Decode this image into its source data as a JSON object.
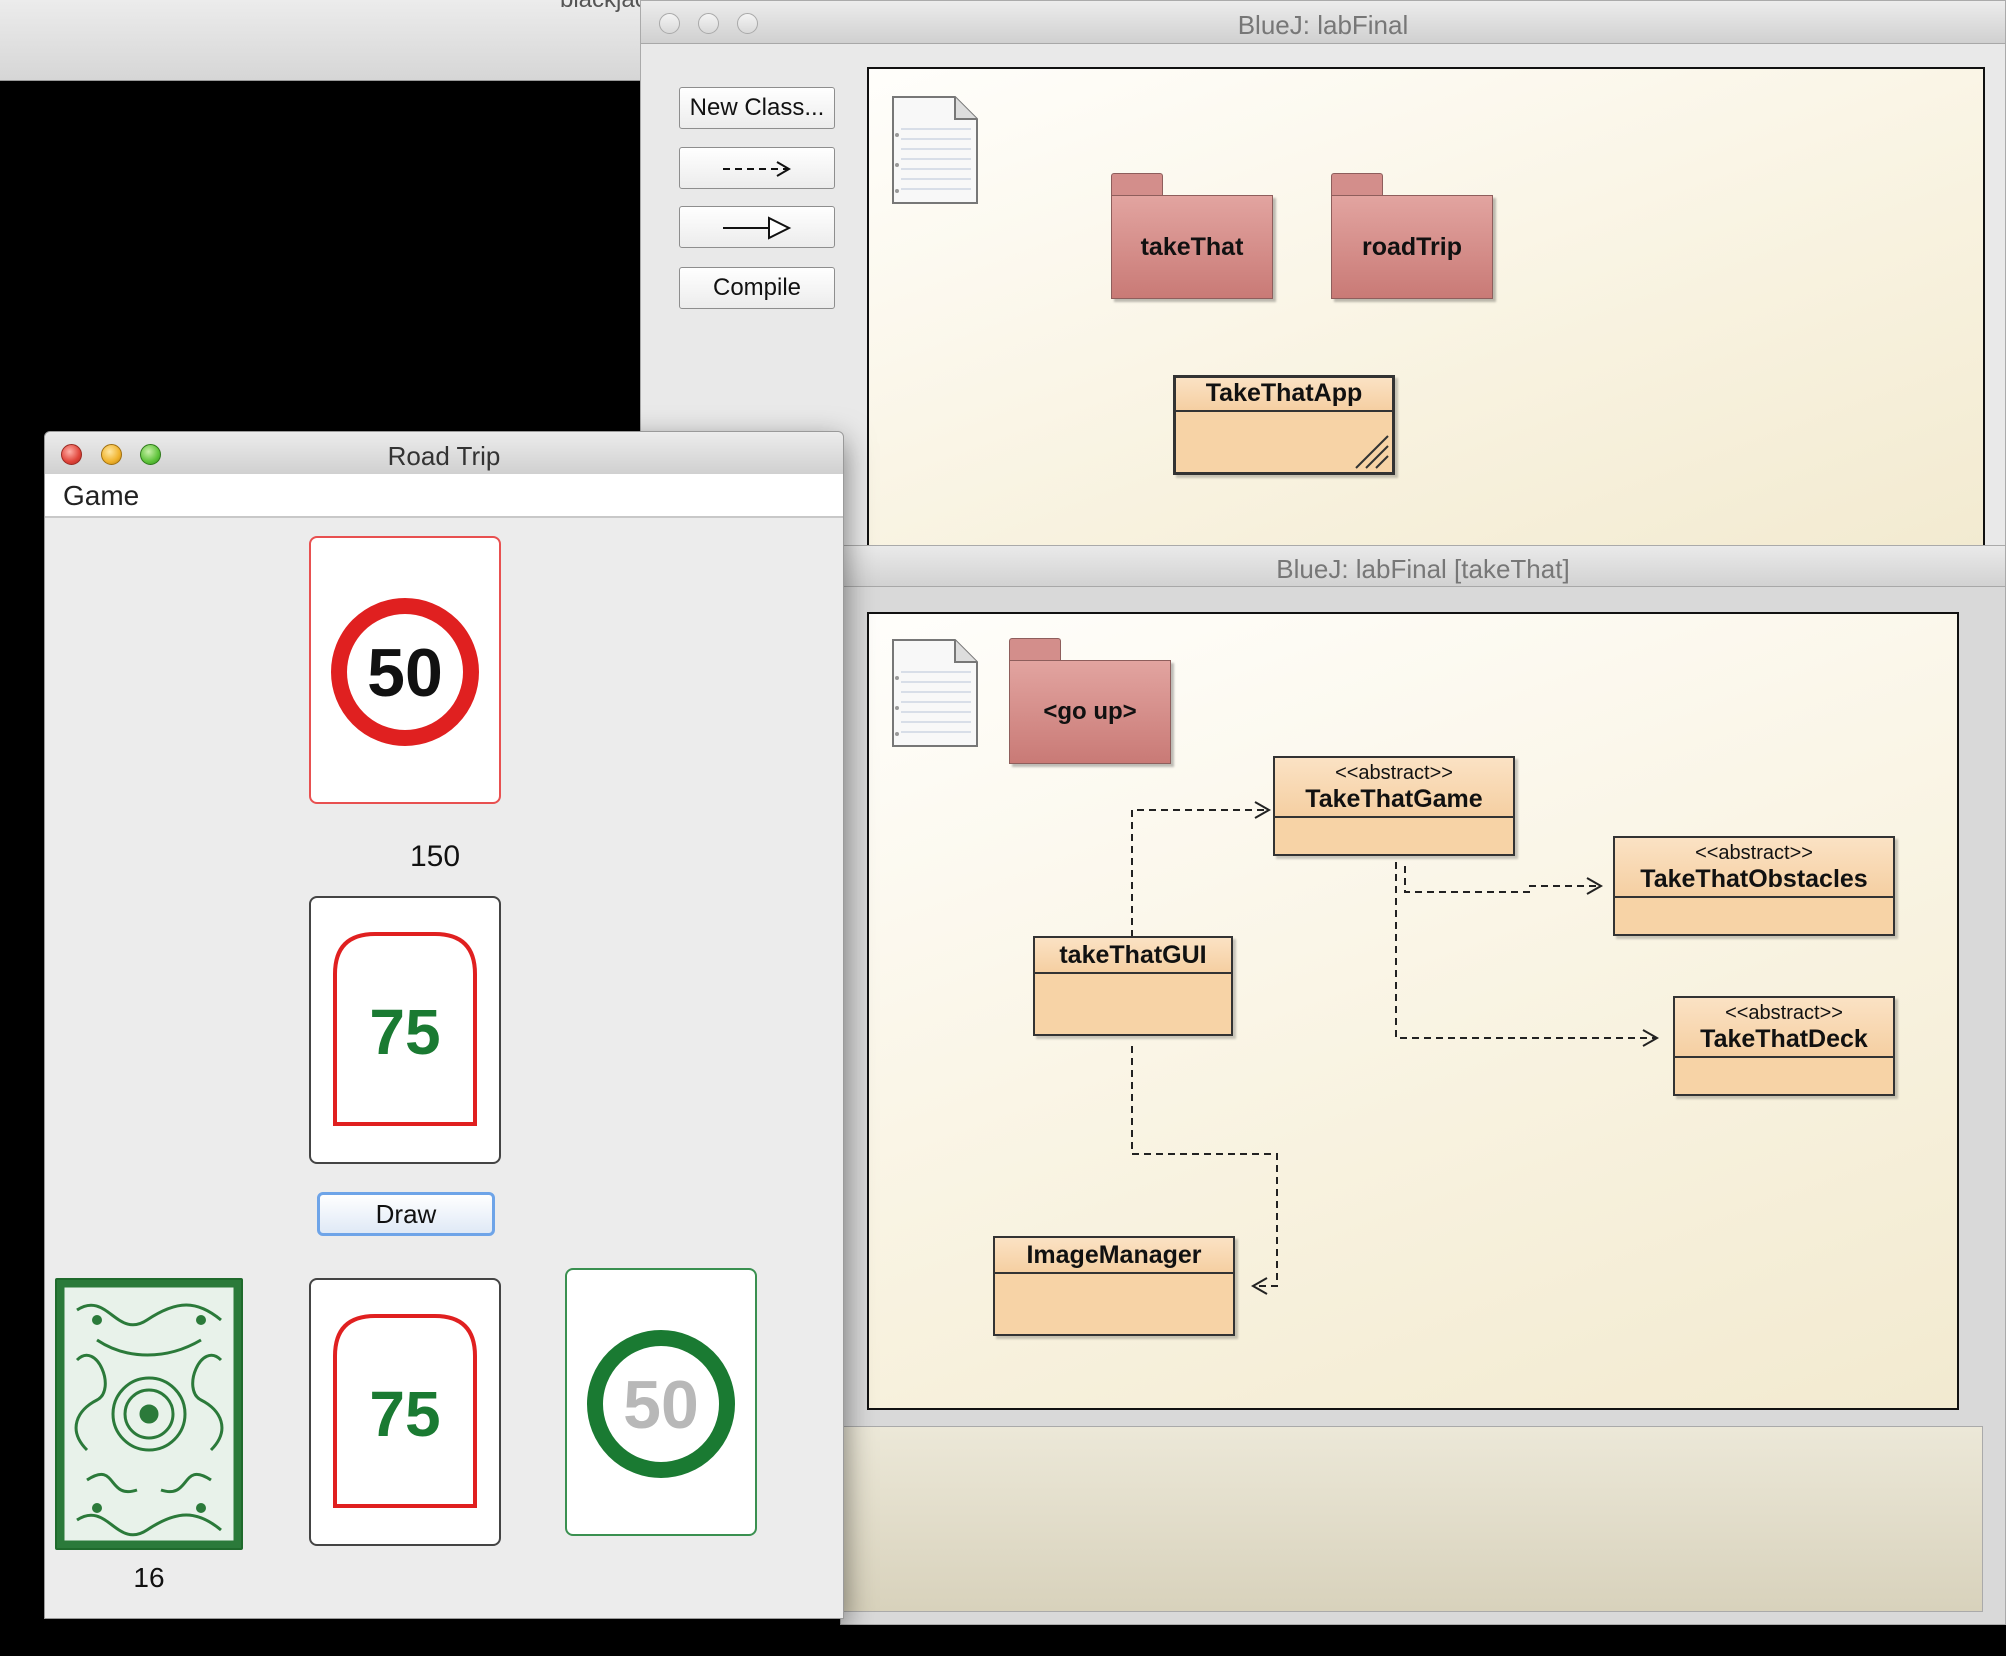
{
  "background_window": {
    "title": "blackjack"
  },
  "bluej_main": {
    "title": "BlueJ:  labFinal",
    "toolbar": {
      "new_class": "New Class...",
      "dep_arrow": "--->",
      "inherit_arrow": "—▷",
      "compile": "Compile"
    },
    "packages": [
      "takeThat",
      "roadTrip"
    ],
    "classes": [
      {
        "name": "TakeThatApp"
      }
    ]
  },
  "bluej_package": {
    "title": "BlueJ:  labFinal  [takeThat]",
    "go_up": "<go up>",
    "classes": [
      {
        "stereotype": "<<abstract>>",
        "name": "TakeThatGame"
      },
      {
        "stereotype": "<<abstract>>",
        "name": "TakeThatObstacles"
      },
      {
        "stereotype": "",
        "name": "takeThatGUI"
      },
      {
        "stereotype": "<<abstract>>",
        "name": "TakeThatDeck"
      },
      {
        "stereotype": "",
        "name": "ImageManager"
      }
    ]
  },
  "road_trip": {
    "title": "Road Trip",
    "menu": "Game",
    "score": "150",
    "draw_button": "Draw",
    "deck_count": "16",
    "cards": {
      "top": {
        "type": "speed-limit",
        "value": "50",
        "color": "#e02020"
      },
      "middle": {
        "type": "go",
        "value": "75",
        "color": "#1a7a32"
      },
      "hand_1": {
        "type": "go",
        "value": "75",
        "color": "#1a7a32"
      },
      "hand_2": {
        "type": "end-limit",
        "value": "50",
        "color": "#1a7a32"
      }
    }
  }
}
